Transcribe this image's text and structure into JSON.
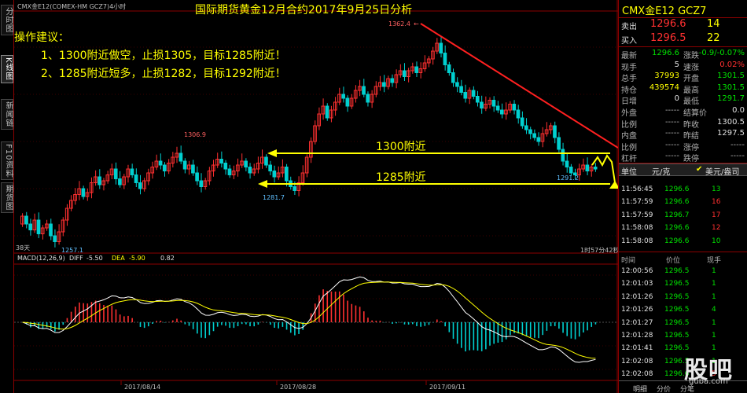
{
  "window": {
    "header_small": "CMX金E12(COMEX-HM GCZ7)4小时",
    "chart_title": "国际期货黄金12月合约2017年9月25日分析"
  },
  "sidebar": {
    "tabs": [
      {
        "label": "分时图",
        "active": false
      },
      {
        "label": "K线图",
        "active": true
      },
      {
        "label": "新闻链",
        "active": false
      },
      {
        "label": "F10资料",
        "active": false
      },
      {
        "label": "期货图",
        "active": false
      }
    ]
  },
  "annotation": {
    "heading": "操作建议：",
    "line1": "1、1300附近做空，止损1305，目标1285附近！",
    "line2": "2、1285附近短多，止损1282，目标1292附近！",
    "level_1300_label": "1300附近",
    "level_1285_label": "1285附近"
  },
  "price_labels": {
    "high_1": "1362.4",
    "high_2": "1306.9",
    "low_1": "1281.7",
    "low_2": "1257.1",
    "low_3": "1291.2",
    "bars_count": "38天",
    "countdown": "1时57分42秒"
  },
  "macd": {
    "label": "MACD(12,26,9)",
    "diff_label": "DIFF",
    "diff_value": "-5.50",
    "dea_label": "DEA",
    "dea_value": "-5.90",
    "macd_value": "0.82"
  },
  "dates": [
    "2017/08/14",
    "2017/08/28",
    "2017/09/11"
  ],
  "quote": {
    "title": "CMX金E12  GCZ7",
    "sell_label": "卖出",
    "sell_price": "1296.6",
    "sell_qty": "14",
    "buy_label": "买入",
    "buy_price": "1296.5",
    "buy_qty": "22",
    "fields": [
      {
        "l1": "最新",
        "v1": "1296.6",
        "c1": "green",
        "l2": "涨跌",
        "v2": "-0.9/-0.07%",
        "c2": "green"
      },
      {
        "l1": "现手",
        "v1": "5",
        "c1": "white",
        "l2": "速涨",
        "v2": "0.02%",
        "c2": "red"
      },
      {
        "l1": "总手",
        "v1": "37993",
        "c1": "yellow",
        "l2": "开盘",
        "v2": "1301.5",
        "c2": "green"
      },
      {
        "l1": "持仓",
        "v1": "439574",
        "c1": "yellow",
        "l2": "最高",
        "v2": "1301.5",
        "c2": "green"
      },
      {
        "l1": "日增",
        "v1": "0",
        "c1": "white",
        "l2": "最低",
        "v2": "1291.7",
        "c2": "green"
      },
      {
        "l1": "外盘",
        "v1": "-----",
        "c1": "grey",
        "l2": "结算价",
        "v2": "0.0",
        "c2": "white"
      },
      {
        "l1": "比例",
        "v1": "-----",
        "c1": "grey",
        "l2": "昨收",
        "v2": "1300.5",
        "c2": "white"
      },
      {
        "l1": "内盘",
        "v1": "-----",
        "c1": "grey",
        "l2": "昨结",
        "v2": "1297.5",
        "c2": "white"
      },
      {
        "l1": "比例",
        "v1": "-----",
        "c1": "grey",
        "l2": "涨停",
        "v2": "-----",
        "c2": "grey"
      },
      {
        "l1": "杠杆",
        "v1": "-----",
        "c1": "grey",
        "l2": "跌停",
        "v2": "-----",
        "c2": "grey"
      }
    ],
    "unit_label": "单位",
    "unit_value": "元/克",
    "unit_selected": "美元/盎司",
    "ticks_top": [
      {
        "time": "11:56:45",
        "price": "1296.6",
        "qty": "13",
        "qc": "green"
      },
      {
        "time": "11:57:59",
        "price": "1296.6",
        "qty": "16",
        "qc": "red"
      },
      {
        "time": "11:57:59",
        "price": "1296.7",
        "qty": "17",
        "qc": "red"
      },
      {
        "time": "11:58:08",
        "price": "1296.6",
        "qty": "12",
        "qc": "red"
      },
      {
        "time": "11:58:08",
        "price": "1296.6",
        "qty": "10",
        "qc": "green"
      }
    ],
    "tick_header": {
      "time": "时间",
      "price": "价位",
      "qty": "现手"
    },
    "ticks_bottom": [
      {
        "time": "12:00:56",
        "price": "1296.5",
        "qty": "1",
        "qc": "green"
      },
      {
        "time": "12:01:03",
        "price": "1296.5",
        "qty": "1",
        "qc": "green"
      },
      {
        "time": "12:01:26",
        "price": "1296.5",
        "qty": "1",
        "qc": "green"
      },
      {
        "time": "12:01:26",
        "price": "1296.5",
        "qty": "4",
        "qc": "green"
      },
      {
        "time": "12:01:27",
        "price": "1296.5",
        "qty": "1",
        "qc": "green"
      },
      {
        "time": "12:01:28",
        "price": "1296.5",
        "qty": "1",
        "qc": "green"
      },
      {
        "time": "12:01:41",
        "price": "1296.5",
        "qty": "1",
        "qc": "green"
      },
      {
        "time": "12:02:08",
        "price": "1296.5",
        "qty": "1",
        "qc": "green"
      },
      {
        "time": "12:02:08",
        "price": "1296.6",
        "qty": "5",
        "qc": "red"
      }
    ],
    "bottom_tabs": [
      "明细",
      "分价",
      "分笔"
    ]
  },
  "watermark": {
    "text": "股吧",
    "sub": "guba.com"
  },
  "colors": {
    "up": "#ff3030",
    "down": "#00d0d0",
    "trend": "#ff2020",
    "level": "#ffff00",
    "grid": "#8b0000"
  }
}
